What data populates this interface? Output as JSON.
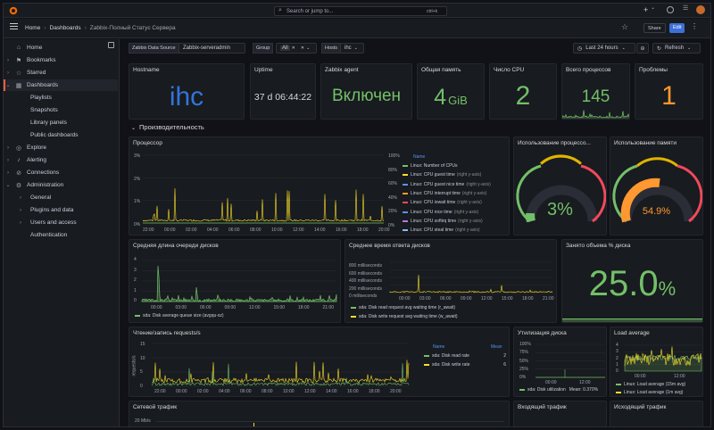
{
  "topbar": {
    "search_placeholder": "Search or jump to...",
    "search_hint": "ctrl+k",
    "plus": "+",
    "plus_caret": "⌄"
  },
  "breadcrumb": {
    "home": "Home",
    "sep": "›",
    "dashboards": "Dashboards",
    "current": "Zabbix-Полный Статус Сервера"
  },
  "actions": {
    "share": "Share",
    "edit": "Edit"
  },
  "sidebar": {
    "items": [
      {
        "label": "Home",
        "icon": "⌂",
        "caret": ""
      },
      {
        "label": "Bookmarks",
        "icon": "⚑",
        "caret": "›"
      },
      {
        "label": "Starred",
        "icon": "☆",
        "caret": "›"
      },
      {
        "label": "Dashboards",
        "icon": "▦",
        "caret": "⌄"
      },
      {
        "label": "Playlists",
        "icon": "",
        "caret": ""
      },
      {
        "label": "Snapshots",
        "icon": "",
        "caret": ""
      },
      {
        "label": "Library panels",
        "icon": "",
        "caret": ""
      },
      {
        "label": "Public dashboards",
        "icon": "",
        "caret": ""
      },
      {
        "label": "Explore",
        "icon": "◎",
        "caret": "›"
      },
      {
        "label": "Alerting",
        "icon": "♪",
        "caret": "›"
      },
      {
        "label": "Connections",
        "icon": "⊘",
        "caret": "›"
      },
      {
        "label": "Administration",
        "icon": "⚙",
        "caret": "⌄"
      },
      {
        "label": "General",
        "icon": "",
        "caret": "›"
      },
      {
        "label": "Plugins and data",
        "icon": "",
        "caret": "›"
      },
      {
        "label": "Users and access",
        "icon": "",
        "caret": "›"
      },
      {
        "label": "Authentication",
        "icon": "",
        "caret": ""
      }
    ]
  },
  "vars": {
    "ds_label": "Zabbix Data Source",
    "ds_value": "Zabbix-serveradmin",
    "group_label": "Group",
    "group_value": "All",
    "hosts_label": "Hosts",
    "hosts_value": "ihc"
  },
  "time": {
    "range": "Last 24 hours",
    "refresh": "Refresh"
  },
  "stats": [
    {
      "title": "Hostname",
      "value": "ihc",
      "color": "#3274d9"
    },
    {
      "title": "Uptime",
      "value": "37 d 06:44:22",
      "color": "#d8d9da"
    },
    {
      "title": "Zabbix agent",
      "value": "Включен",
      "color": "#73bf69"
    },
    {
      "title": "Общая память",
      "value": "4",
      "unit": "GiB",
      "color": "#73bf69"
    },
    {
      "title": "Число CPU",
      "value": "2",
      "color": "#73bf69"
    },
    {
      "title": "Всего процессов",
      "value": "145",
      "color": "#73bf69"
    },
    {
      "title": "Проблемы",
      "value": "1",
      "color": "#ff9830"
    }
  ],
  "row_title": "Производительность",
  "cpu": {
    "title": "Процессор",
    "left_ticks": [
      "3%",
      "2%",
      "1%",
      "0%"
    ],
    "right_ticks": [
      "100%",
      "80%",
      "60%",
      "40%",
      "20%",
      "0%"
    ],
    "x_ticks": [
      "22:00",
      "00:00",
      "02:00",
      "04:00",
      "06:00",
      "08:00",
      "10:00",
      "12:00",
      "14:00",
      "16:00",
      "18:00",
      "20:00"
    ],
    "legend_header": "Name",
    "legend": [
      {
        "name": "Linux: Number of CPUs",
        "suffix": "",
        "color": "#73bf69"
      },
      {
        "name": "Linux: CPU guest time",
        "suffix": "(right y-axis)",
        "color": "#fade2a"
      },
      {
        "name": "Linux: CPU guest nice time",
        "suffix": "(right y-axis)",
        "color": "#5794f2"
      },
      {
        "name": "Linux: CPU interrupt time",
        "suffix": "(right y-axis)",
        "color": "#ff9830"
      },
      {
        "name": "Linux: CPU iowait time",
        "suffix": "(right y-axis)",
        "color": "#f2495c"
      },
      {
        "name": "Linux: CPU nice time",
        "suffix": "(right y-axis)",
        "color": "#5794f2"
      },
      {
        "name": "Linux: CPU softirq time",
        "suffix": "(right y-axis)",
        "color": "#b877d9"
      },
      {
        "name": "Linux: CPU steal time",
        "suffix": "(right y-axis)",
        "color": "#8ab8ff"
      }
    ]
  },
  "gauge_cpu": {
    "title": "Использование процессо...",
    "value": "3%",
    "color": "#73bf69"
  },
  "gauge_mem": {
    "title": "Использование памяти",
    "value": "54.9%",
    "color": "#ff9830"
  },
  "diskq": {
    "title": "Средняя длина очереди дисков",
    "y_ticks": [
      "4",
      "3",
      "2",
      "1",
      "0"
    ],
    "x_ticks": [
      "00:00",
      "03:00",
      "06:00",
      "09:00",
      "12:00",
      "15:00",
      "18:00",
      "21:00"
    ],
    "legend": "sda: Disk average queue size (avgqu-sz)"
  },
  "diskt": {
    "title": "Среднее время ответа дисков",
    "y_ticks": [
      "800 milliseconds",
      "600 milliseconds",
      "400 milliseconds",
      "200 milliseconds",
      "0 milliseconds"
    ],
    "x_ticks": [
      "00:00",
      "03:00",
      "06:00",
      "09:00",
      "12:00",
      "15:00",
      "18:00",
      "21:00"
    ],
    "legend": [
      "sda: Disk read request avg waiting time (r_await)",
      "sda: Disk write request avg waiting time (w_await)"
    ]
  },
  "diskused": {
    "title": "Занято объема % диска",
    "value": "25.0",
    "unit": "%"
  },
  "rw": {
    "title": "Чтение/запись requests/s",
    "ylabel": "requests/s",
    "y_ticks": [
      "15",
      "10",
      "5",
      "0"
    ],
    "x_ticks": [
      "22:00",
      "00:00",
      "02:00",
      "04:00",
      "06:00",
      "08:00",
      "10:00",
      "12:00",
      "14:00",
      "16:00",
      "18:00",
      "20:00"
    ],
    "legend_name": "Name",
    "legend_mean": "Mean",
    "legend": [
      {
        "name": "sda: Disk read rate",
        "mean": "2",
        "color": "#73bf69"
      },
      {
        "name": "sda: Disk write rate",
        "mean": "6",
        "color": "#fade2a"
      }
    ]
  },
  "util": {
    "title": "Утилизация диска",
    "y_ticks": [
      "100%",
      "75%",
      "50%",
      "25%",
      "0%"
    ],
    "x_ticks": [
      "00:00",
      "12:00"
    ],
    "legend": "sda: Disk utilization",
    "mean": "Mean: 0.370%"
  },
  "load": {
    "title": "Load average",
    "y_ticks": [
      "4",
      "3",
      "2",
      "1",
      "0"
    ],
    "x_ticks": [
      "00:00",
      "12:00"
    ],
    "legend": [
      "Linux: Load average (15m avg)",
      "Linux: Load average (1m avg)"
    ]
  },
  "net": {
    "title": "Сетевой трафик",
    "y_tick": "20 Mb/s"
  },
  "net_in": {
    "title": "Входящий трафик"
  },
  "net_out": {
    "title": "Исходящий трафик"
  }
}
